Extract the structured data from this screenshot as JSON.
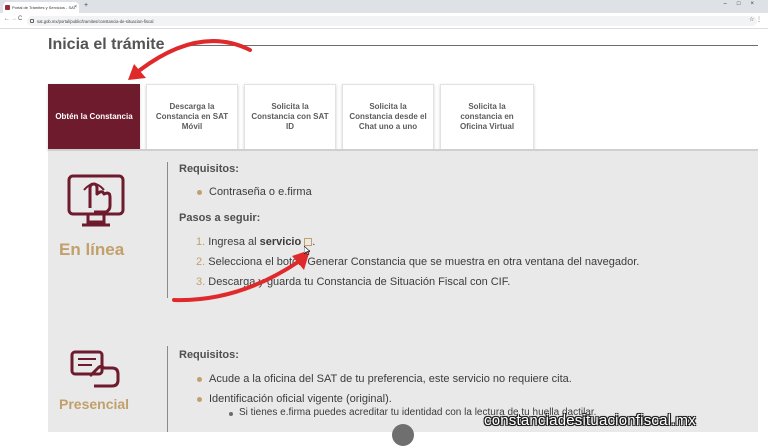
{
  "browser": {
    "tab_title": "Portal de Trámites y Servicios - SAT",
    "url": "sat.gob.mx/portal/public/tramites/constancia-de-situacion-fiscal",
    "new_tab": "+",
    "nav_back": "←",
    "nav_forward": "→",
    "nav_reload": "C",
    "toolbar_right": "☆  ⋮"
  },
  "page": {
    "title": "Inicia el trámite"
  },
  "tabs": [
    {
      "label": "Obtén la Constancia",
      "active": true
    },
    {
      "label": "Descarga la Constancia en SAT Móvil",
      "active": false
    },
    {
      "label": "Solicita la Constancia con SAT ID",
      "active": false
    },
    {
      "label": "Solicita la Constancia desde el Chat uno a uno",
      "active": false
    },
    {
      "label": "Solicita la constancia en Oficina Virtual",
      "active": false
    }
  ],
  "online": {
    "label": "En línea",
    "icon": "online-hand-click-icon",
    "requirements_heading": "Requisitos:",
    "requirements": [
      "Contraseña o e.firma"
    ],
    "steps_heading": "Pasos a seguir:",
    "steps": [
      {
        "num": "1.",
        "text_before": "Ingresa al ",
        "link": "servicio",
        "text_after": "."
      },
      {
        "num": "2.",
        "text": "Selecciona el botón Generar Constancia que se muestra en otra ventana del navegador."
      },
      {
        "num": "3.",
        "text": "Descarga y guarda tu Constancia de Situación Fiscal con CIF."
      }
    ]
  },
  "presencial": {
    "label": "Presencial",
    "icon": "presencial-document-hand-icon",
    "requirements_heading": "Requisitos:",
    "requirements": [
      "Acude a la oficina del SAT de tu preferencia, este servicio no requiere cita.",
      "Identificación oficial vigente (original)."
    ],
    "sub_requirements": [
      "Si tienes e.firma puedes acreditar tu identidad con la lectura de tu huella dactilar."
    ]
  },
  "watermark": "constanciadesituacionfiscal.mx",
  "colors": {
    "brand_primary": "#6d1b2d",
    "accent_gold": "#c1a06b",
    "annotation_red": "#e0292b",
    "panel_bg": "#e9e9e9"
  }
}
